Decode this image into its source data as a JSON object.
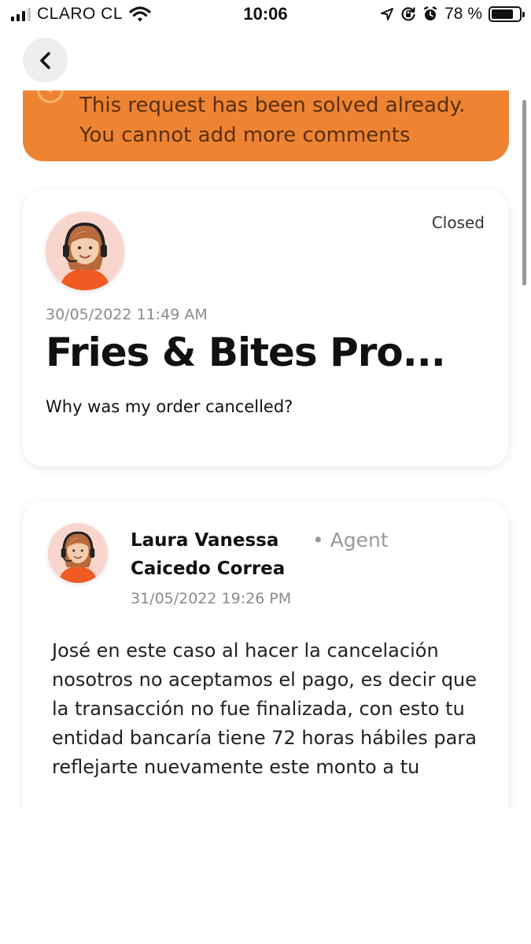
{
  "status_bar": {
    "carrier": "CLARO CL",
    "time": "10:06",
    "battery": "78 %",
    "battery_level": 0.78,
    "icons": [
      "signal-icon",
      "wifi-icon",
      "location-icon",
      "rotation-lock-icon",
      "alarm-icon",
      "battery-icon"
    ]
  },
  "nav": {
    "back_icon": "chevron-left-icon"
  },
  "banner": {
    "text": "This request has been solved already. You cannot add more comments",
    "color": "#ee8432",
    "icon": "info-icon"
  },
  "request": {
    "status": "Closed",
    "date": "30/05/2022 11:49 AM",
    "title": "Fries &  Bites Pro...",
    "question": "Why was my order cancelled?",
    "avatar": "agent-avatar"
  },
  "comment": {
    "author": "Laura Vanessa Caicedo Correa",
    "role": "• Agent",
    "date": "31/05/2022 19:26 PM",
    "body": "José en este caso al hacer la cancelación nosotros no aceptamos el pago, es decir que la transacción no fue finalizada, con esto tu entidad bancaría tiene 72 horas hábiles para reflejarte nuevamente este monto a tu"
  }
}
